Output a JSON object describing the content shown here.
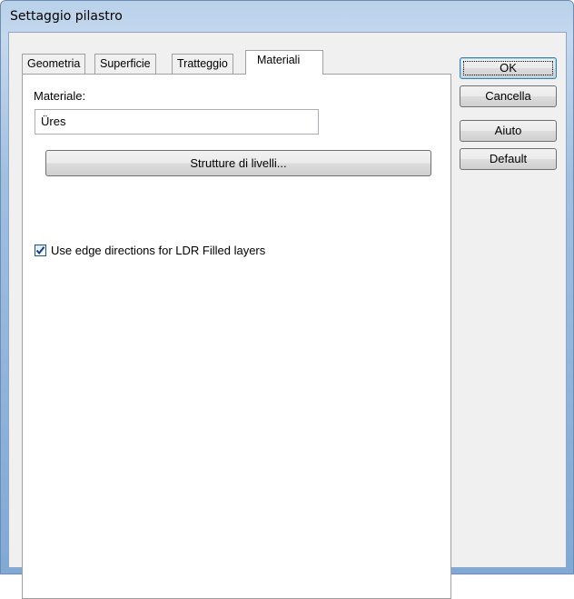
{
  "window": {
    "title": "Settaggio pilastro"
  },
  "tabs": [
    {
      "label": "Geometria"
    },
    {
      "label": "Superficie"
    },
    {
      "label": "Tratteggio"
    },
    {
      "label": "Materiali"
    }
  ],
  "panel": {
    "material_label": "Materiale:",
    "material_value": "Üres",
    "layer_button_label": "Strutture di livelli...",
    "edge_checkbox": {
      "label": "Use edge directions for LDR Filled layers",
      "checked": true
    }
  },
  "buttons": {
    "ok": "OK",
    "cancel": "Cancella",
    "help": "Aiuto",
    "default": "Default"
  }
}
